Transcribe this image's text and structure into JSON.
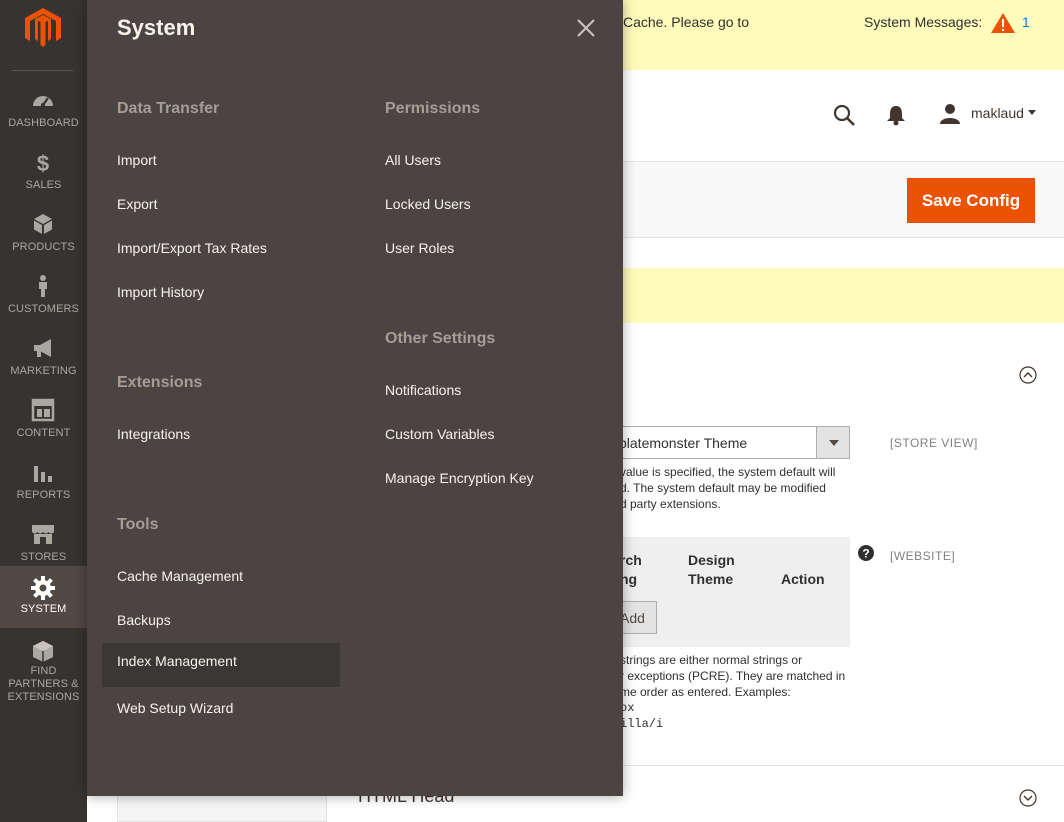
{
  "sidebar": {
    "logo": "magento-logo",
    "items": [
      {
        "label": "DASHBOARD",
        "icon": "dashboard-icon"
      },
      {
        "label": "SALES",
        "icon": "dollar-icon"
      },
      {
        "label": "PRODUCTS",
        "icon": "cube-icon"
      },
      {
        "label": "CUSTOMERS",
        "icon": "person-icon"
      },
      {
        "label": "MARKETING",
        "icon": "megaphone-icon"
      },
      {
        "label": "CONTENT",
        "icon": "layout-icon"
      },
      {
        "label": "REPORTS",
        "icon": "bar-chart-icon"
      },
      {
        "label": "STORES",
        "icon": "store-icon"
      },
      {
        "label": "SYSTEM",
        "icon": "gear-icon",
        "active": true
      },
      {
        "label": "FIND PARTNERS & EXTENSIONS",
        "icon": "extensions-icon"
      }
    ]
  },
  "page": {
    "notice_top": "Cache. Please go to",
    "system_messages_label": "System Messages:",
    "system_messages_count": "1",
    "user_name": "maklaud",
    "save_button": "Save Config",
    "theme_select_value": "platemonster Theme",
    "scope_store_view": "[STORE VIEW]",
    "scope_website": "[WEBSITE]",
    "theme_note": [
      "value is specified, the system default will",
      "d. The system default may be modified",
      "d party extensions."
    ],
    "grid_headers": {
      "col1": [
        "rch",
        "ng"
      ],
      "col2": [
        "Design",
        "Theme"
      ],
      "col3": "Action"
    },
    "add_button": "Add",
    "regex_note": [
      "strings are either normal strings or",
      "r exceptions (PCRE). They are matched in",
      "me order as entered. Examples:"
    ],
    "regex_examples": [
      "ox",
      "illa/i"
    ],
    "html_head_title": "HTML Head"
  },
  "menu": {
    "title": "System",
    "groups": {
      "data_transfer": {
        "title": "Data Transfer",
        "items": [
          "Import",
          "Export",
          "Import/Export Tax Rates",
          "Import History"
        ]
      },
      "extensions": {
        "title": "Extensions",
        "items": [
          "Integrations"
        ]
      },
      "tools": {
        "title": "Tools",
        "items": [
          "Cache Management",
          "Backups",
          "Index Management",
          "Web Setup Wizard"
        ]
      },
      "permissions": {
        "title": "Permissions",
        "items": [
          "All Users",
          "Locked Users",
          "User Roles"
        ]
      },
      "other_settings": {
        "title": "Other Settings",
        "items": [
          "Notifications",
          "Custom Variables",
          "Manage Encryption Key"
        ]
      }
    },
    "highlighted_item": "Index Management"
  },
  "colors": {
    "sidebar_bg": "#373330",
    "menu_bg": "#4a4542",
    "accent": "#eb5202",
    "notice_bg": "#fffbbb",
    "group_title": "#a79d95"
  }
}
